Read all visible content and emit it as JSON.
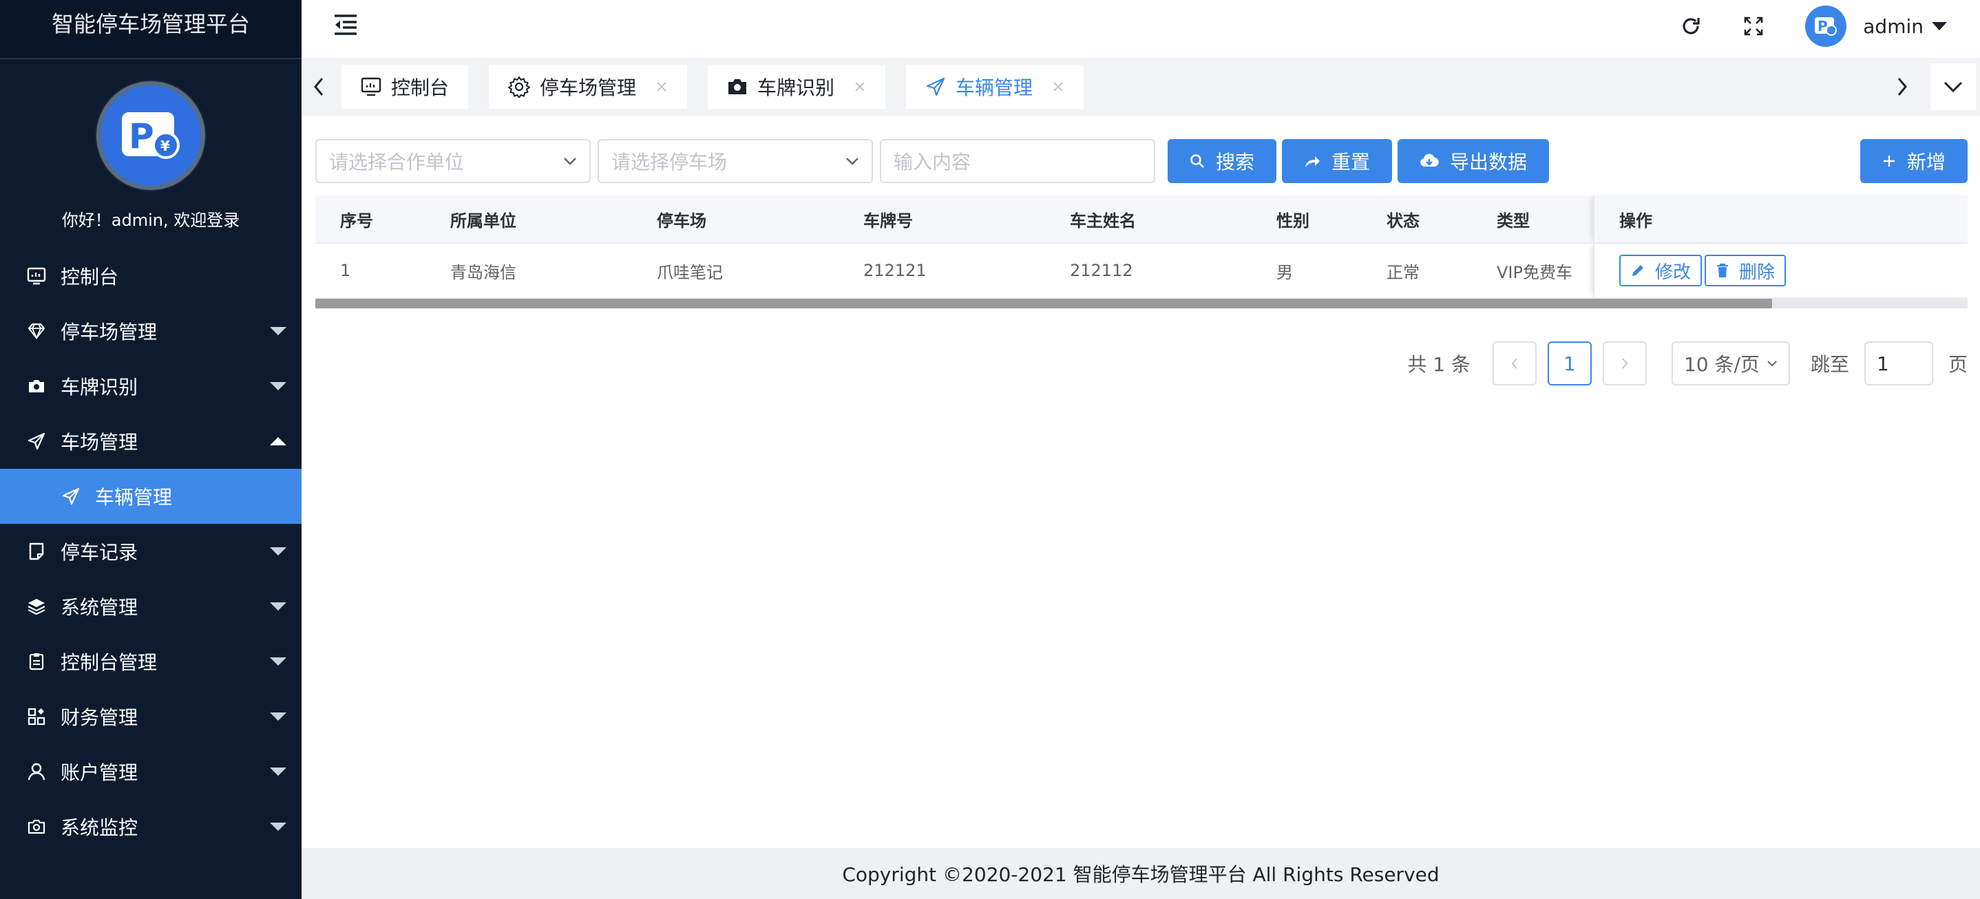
{
  "app": {
    "title": "智能停车场管理平台",
    "welcome": "你好！admin, 欢迎登录"
  },
  "sidebar": {
    "items": [
      {
        "label": "控制台",
        "icon": "dashboard-icon"
      },
      {
        "label": "停车场管理",
        "icon": "diamond-icon"
      },
      {
        "label": "车牌识别",
        "icon": "camera-icon"
      },
      {
        "label": "车场管理",
        "icon": "send-icon"
      },
      {
        "label": "车辆管理",
        "icon": "send-icon"
      },
      {
        "label": "停车记录",
        "icon": "note-icon"
      },
      {
        "label": "系统管理",
        "icon": "layers-icon"
      },
      {
        "label": "控制台管理",
        "icon": "clipboard-icon"
      },
      {
        "label": "财务管理",
        "icon": "apps-icon"
      },
      {
        "label": "账户管理",
        "icon": "user-icon"
      },
      {
        "label": "系统监控",
        "icon": "camera-outline-icon"
      }
    ]
  },
  "header": {
    "username": "admin"
  },
  "tabs": [
    {
      "label": "控制台"
    },
    {
      "label": "停车场管理"
    },
    {
      "label": "车牌识别"
    },
    {
      "label": "车辆管理"
    }
  ],
  "filters": {
    "partner_placeholder": "请选择合作单位",
    "parking_placeholder": "请选择停车场",
    "keyword_placeholder": "输入内容",
    "search_label": "搜索",
    "reset_label": "重置",
    "export_label": "导出数据",
    "add_label": "新增"
  },
  "table": {
    "columns": [
      "序号",
      "所属单位",
      "停车场",
      "车牌号",
      "车主姓名",
      "性别",
      "状态",
      "类型",
      "操作"
    ],
    "rows": [
      {
        "index": "1",
        "unit": "青岛海信",
        "parking": "爪哇笔记",
        "plate": "212121",
        "owner": "212112",
        "gender": "男",
        "status": "正常",
        "type": "VIP免费车",
        "edit_label": "修改",
        "delete_label": "删除"
      }
    ]
  },
  "pagination": {
    "total_text": "共 1 条",
    "current_page": "1",
    "page_size": "10 条/页",
    "goto_label": "跳至",
    "goto_value": "1",
    "page_suffix": "页"
  },
  "footer": {
    "copyright": "Copyright ©2020-2021 智能停车场管理平台 All Rights Reserved"
  },
  "colors": {
    "sidebar_bg": "#0e1b2f",
    "accent": "#3a86e8"
  }
}
